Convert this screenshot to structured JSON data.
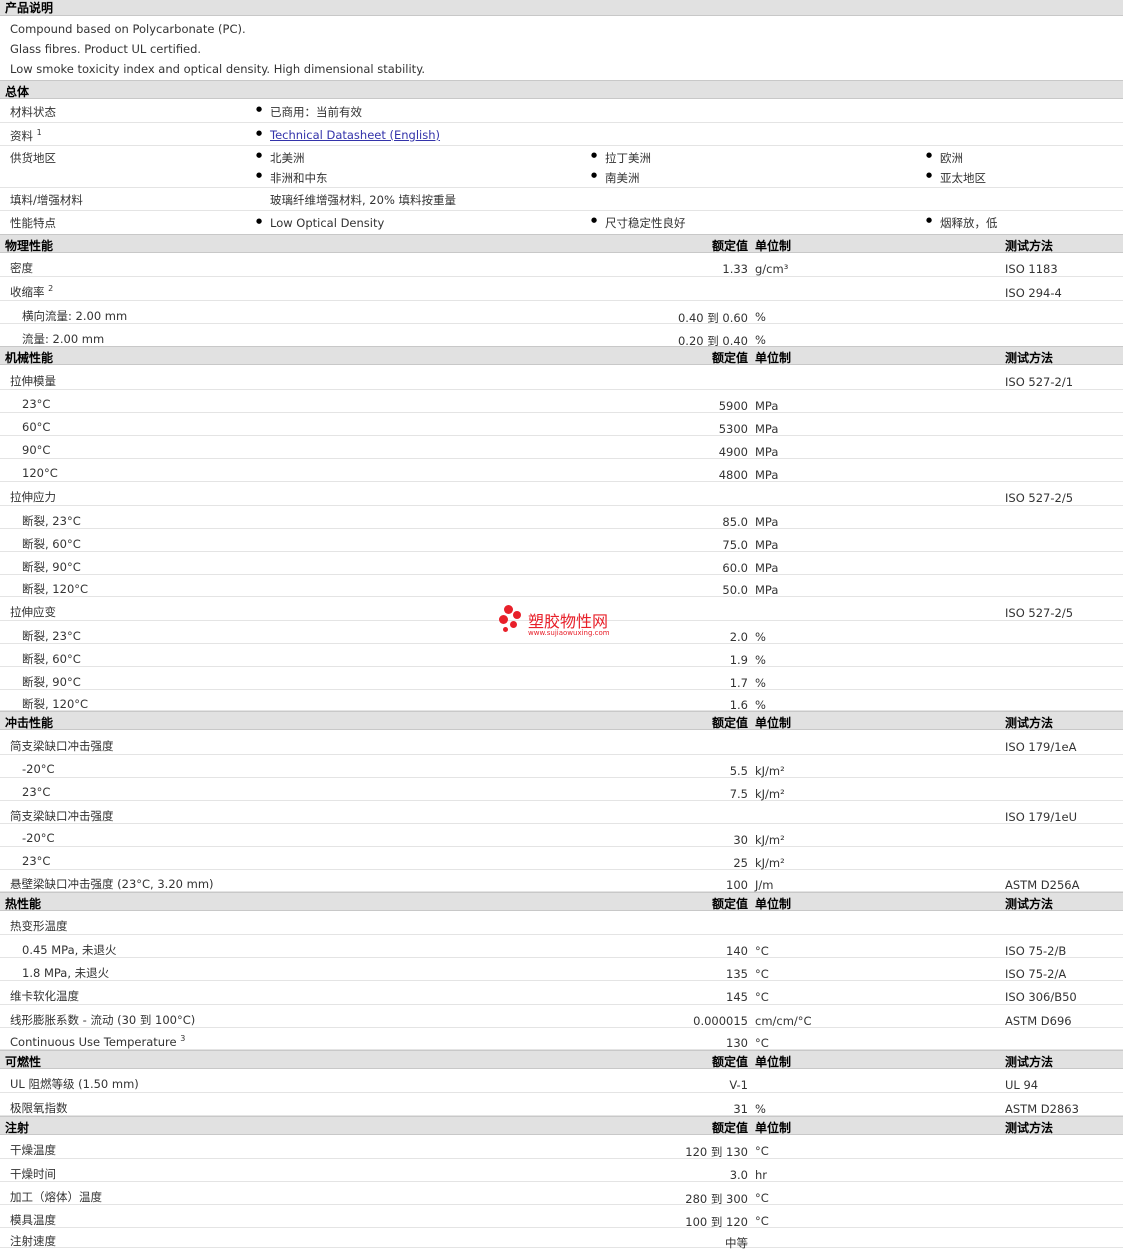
{
  "intro": {
    "title": "产品说明",
    "lines": [
      "Compound based on Polycarbonate (PC).",
      "Glass fibres. Product UL certified.",
      "Low smoke toxicity index and optical density. High dimensional stability."
    ]
  },
  "general": {
    "title": "总体",
    "status_label": "材料状态",
    "status_value": "已商用：当前有效",
    "docs_label": "资料",
    "docs_note": "1",
    "docs_link": "Technical Datasheet (English)",
    "region_label": "供货地区",
    "regions": [
      "北美洲",
      "拉丁美洲",
      "欧洲",
      "非洲和中东",
      "南美洲",
      "亚太地区"
    ],
    "filler_label": "填料/增强材料",
    "filler_value": "玻璃纤维增强材料, 20% 填料按重量",
    "features_label": "性能特点",
    "features": [
      "Low Optical Density",
      "尺寸稳定性良好",
      "烟释放，低"
    ]
  },
  "headers": {
    "value": "额定值",
    "unit": "单位制",
    "method": "测试方法"
  },
  "sections": {
    "physical": "物理性能",
    "mechanical": "机械性能",
    "impact": "冲击性能",
    "thermal": "热性能",
    "flammability": "可燃性",
    "injection": "注射"
  },
  "rows": {
    "density": {
      "label": "密度",
      "value": "1.33",
      "unit": "g/cm³",
      "method": "ISO 1183"
    },
    "shrink": {
      "label": "收缩率",
      "note": "2",
      "method": "ISO 294-4"
    },
    "shrink_t": {
      "label": "横向流量: 2.00 mm",
      "value": "0.40 到  0.60",
      "unit": "%"
    },
    "shrink_f": {
      "label": "流量: 2.00 mm",
      "value": "0.20 到  0.40",
      "unit": "%"
    },
    "tmod": {
      "label": "拉伸模量",
      "method": "ISO 527-2/1"
    },
    "tmod1": {
      "label": "23°C",
      "value": "5900",
      "unit": "MPa"
    },
    "tmod2": {
      "label": "60°C",
      "value": "5300",
      "unit": "MPa"
    },
    "tmod3": {
      "label": "90°C",
      "value": "4900",
      "unit": "MPa"
    },
    "tmod4": {
      "label": "120°C",
      "value": "4800",
      "unit": "MPa"
    },
    "tstr": {
      "label": "拉伸应力",
      "method": "ISO 527-2/5"
    },
    "tstr1": {
      "label": "断裂, 23°C",
      "value": "85.0",
      "unit": "MPa"
    },
    "tstr2": {
      "label": "断裂, 60°C",
      "value": "75.0",
      "unit": "MPa"
    },
    "tstr3": {
      "label": "断裂, 90°C",
      "value": "60.0",
      "unit": "MPa"
    },
    "tstr4": {
      "label": "断裂, 120°C",
      "value": "50.0",
      "unit": "MPa"
    },
    "tstn": {
      "label": "拉伸应变",
      "method": "ISO 527-2/5"
    },
    "tstn1": {
      "label": "断裂, 23°C",
      "value": "2.0",
      "unit": "%"
    },
    "tstn2": {
      "label": "断裂, 60°C",
      "value": "1.9",
      "unit": "%"
    },
    "tstn3": {
      "label": "断裂, 90°C",
      "value": "1.7",
      "unit": "%"
    },
    "tstn4": {
      "label": "断裂, 120°C",
      "value": "1.6",
      "unit": "%"
    },
    "ch1": {
      "label": "简支梁缺口冲击强度",
      "method": "ISO 179/1eA"
    },
    "ch1a": {
      "label": "-20°C",
      "value": "5.5",
      "unit": "kJ/m²"
    },
    "ch1b": {
      "label": "23°C",
      "value": "7.5",
      "unit": "kJ/m²"
    },
    "ch2": {
      "label": "简支梁缺口冲击强度",
      "method": "ISO 179/1eU"
    },
    "ch2a": {
      "label": "-20°C",
      "value": "30",
      "unit": "kJ/m²"
    },
    "ch2b": {
      "label": "23°C",
      "value": "25",
      "unit": "kJ/m²"
    },
    "izod": {
      "label": "悬壁梁缺口冲击强度 (23°C, 3.20 mm)",
      "value": "100",
      "unit": "J/m",
      "method": "ASTM D256A"
    },
    "hdt": {
      "label": "热变形温度"
    },
    "hdt1": {
      "label": "0.45 MPa, 未退火",
      "value": "140",
      "unit": "°C",
      "method": "ISO 75-2/B"
    },
    "hdt2": {
      "label": "1.8 MPa, 未退火",
      "value": "135",
      "unit": "°C",
      "method": "ISO 75-2/A"
    },
    "vicat": {
      "label": "维卡软化温度",
      "value": "145",
      "unit": "°C",
      "method": "ISO 306/B50"
    },
    "clte": {
      "label": "线形膨胀系数 - 流动 (30 到  100°C)",
      "value": "0.000015",
      "unit": "cm/cm/°C",
      "method": "ASTM D696"
    },
    "cut": {
      "label": "Continuous Use Temperature",
      "note": "3",
      "value": "130",
      "unit": "°C"
    },
    "ul": {
      "label": "UL 阻燃等级 (1.50 mm)",
      "value": "V-1",
      "method": "UL 94"
    },
    "loi": {
      "label": "极限氧指数",
      "value": "31",
      "unit": "%",
      "method": "ASTM D2863"
    },
    "dryt": {
      "label": "干燥温度",
      "value": "120 到  130",
      "unit": "°C"
    },
    "dryh": {
      "label": "干燥时间",
      "value": "3.0",
      "unit": "hr"
    },
    "melt": {
      "label": "加工（熔体）温度",
      "value": "280 到  300",
      "unit": "°C"
    },
    "mold": {
      "label": "模具温度",
      "value": "100 到  120",
      "unit": "°C"
    },
    "inj": {
      "label": "注射速度",
      "value": "中等"
    }
  },
  "watermark": {
    "title": "塑胶物性网",
    "url": "www.sujiaowuxing.com"
  }
}
